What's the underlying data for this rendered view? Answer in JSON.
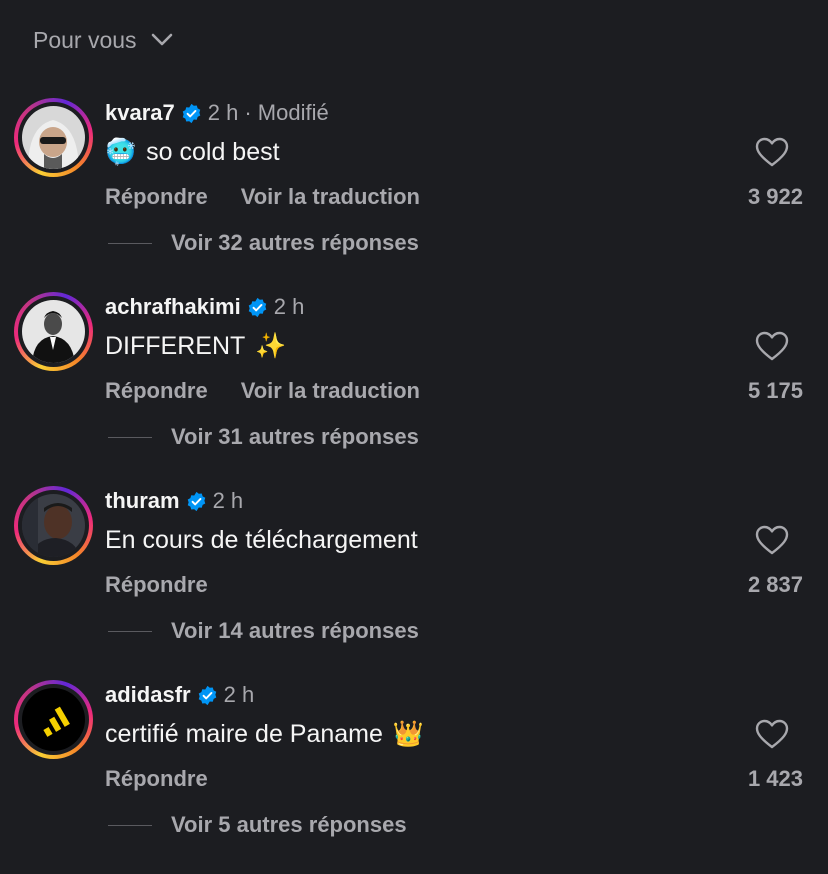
{
  "header": {
    "filter_label": "Pour vous"
  },
  "comments": [
    {
      "username": "kvara7",
      "time": "2 h",
      "edited": "· Modifié",
      "emoji": "🥶",
      "text": "so cold best",
      "reply": "Répondre",
      "translate": "Voir la traduction",
      "likes": "3 922",
      "more_replies": "Voir 32 autres réponses"
    },
    {
      "username": "achrafhakimi",
      "time": "2 h",
      "text": "DIFFERENT",
      "emoji": "✨",
      "reply": "Répondre",
      "translate": "Voir la traduction",
      "likes": "5 175",
      "more_replies": "Voir 31 autres réponses"
    },
    {
      "username": "thuram",
      "time": "2 h",
      "text": "En cours de téléchargement",
      "reply": "Répondre",
      "likes": "2 837",
      "more_replies": "Voir 14 autres réponses"
    },
    {
      "username": "adidasfr",
      "time": "2 h",
      "text": "certifié maire de Paname",
      "emoji": "👑",
      "reply": "Répondre",
      "likes": "1 423",
      "more_replies": "Voir 5 autres réponses"
    }
  ],
  "colors": {
    "background": "#1c1d21",
    "text_primary": "#f5f5f5",
    "text_secondary": "#a8a8ad",
    "verified_blue": "#0095f6",
    "adidas_yellow": "#f5d000"
  }
}
